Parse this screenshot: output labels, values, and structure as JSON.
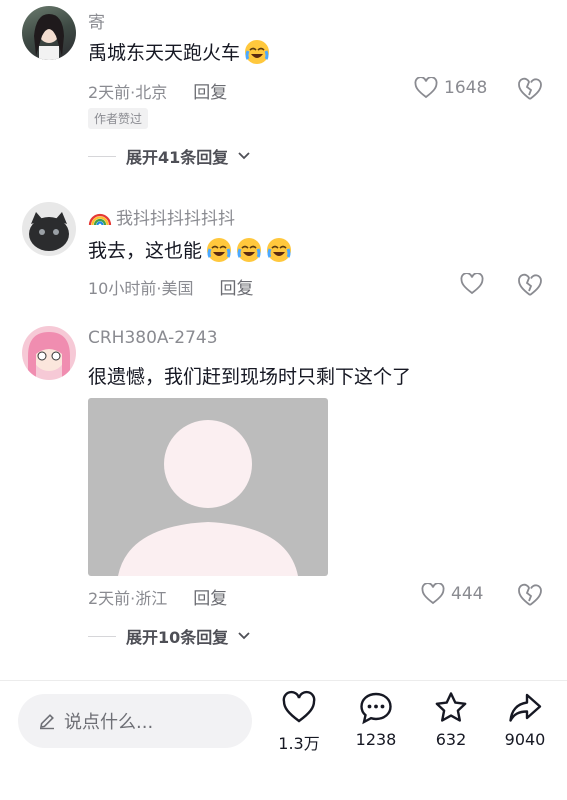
{
  "comments": [
    {
      "username": "寄",
      "text": "禹城东天天跑火车",
      "time_location": "2天前·北京",
      "reply_label": "回复",
      "likes": "1648",
      "badge": "作者赞过",
      "expand": "展开41条回复"
    },
    {
      "username": "我抖抖抖抖抖抖",
      "text": "我去，这也能",
      "time_location": "10小时前·美国",
      "reply_label": "回复"
    },
    {
      "username": "CRH380A-2743",
      "text": "很遗憾，我们赶到现场时只剩下这个了",
      "time_location": "2天前·浙江",
      "reply_label": "回复",
      "likes": "444",
      "expand": "展开10条回复"
    }
  ],
  "bottom_bar": {
    "input_placeholder": "说点什么...",
    "like_count": "1.3万",
    "comment_count": "1238",
    "favorite_count": "632",
    "share_count": "9040"
  },
  "colors": {
    "text_primary": "#161823",
    "text_secondary": "#8a8b91",
    "placeholder_bg": "#bcbcbc",
    "placeholder_figure": "#fbeff1"
  },
  "icons": [
    "heart-icon",
    "broken-heart-icon",
    "chevron-down-icon",
    "rainbow-icon",
    "crying-laughing-emoji-icon",
    "pencil-icon",
    "comment-icon",
    "star-icon",
    "share-icon"
  ]
}
